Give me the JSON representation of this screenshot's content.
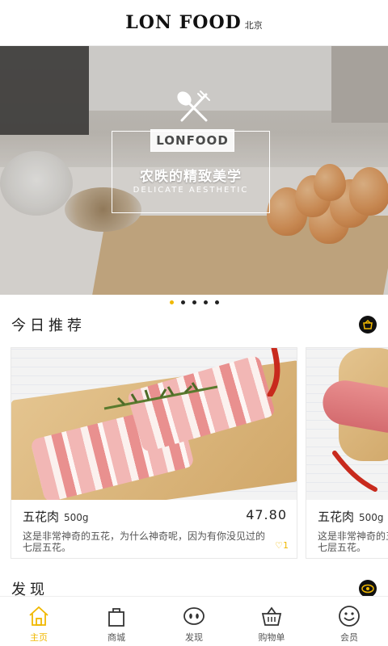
{
  "header": {
    "brand": "LON FOOD",
    "city": "北京"
  },
  "banner": {
    "logo_title": "LONFOOD",
    "slogan_cn": "农昳的精致美学",
    "slogan_en": "DELICATE AESTHETIC",
    "icon": "fork-spoon-icon"
  },
  "carousel": {
    "count": 5,
    "active_index": 0
  },
  "today": {
    "title": "今日推荐",
    "icon": "basket-icon"
  },
  "products": [
    {
      "name": "五花肉",
      "weight": "500g",
      "price": "47.80",
      "desc": "这是非常神奇的五花，为什么神奇呢，因为有你没见过的七层五花。",
      "likes": "1"
    },
    {
      "name": "五花肉",
      "weight": "500g",
      "price": "",
      "desc": "这是非常神奇的五花，为什么神奇呢，因为有你没见过的七层五花。",
      "likes": ""
    }
  ],
  "discover": {
    "title": "发现",
    "icon": "eye-icon"
  },
  "tabs": [
    {
      "label": "主页",
      "icon": "home-icon",
      "active": true
    },
    {
      "label": "商城",
      "icon": "shopping-bag-icon",
      "active": false
    },
    {
      "label": "发现",
      "icon": "discover-icon",
      "active": false
    },
    {
      "label": "购物单",
      "icon": "cart-icon",
      "active": false
    },
    {
      "label": "会员",
      "icon": "member-icon",
      "active": false
    }
  ],
  "colors": {
    "accent": "#f0b800",
    "text": "#222222"
  }
}
